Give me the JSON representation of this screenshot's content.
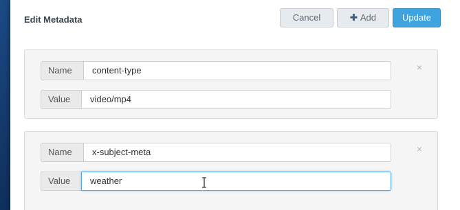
{
  "dialog": {
    "title": "Edit Metadata"
  },
  "toolbar": {
    "cancel_label": "Cancel",
    "add_icon": "plus-icon",
    "add_label": "Add",
    "update_label": "Update"
  },
  "entries": [
    {
      "name_label": "Name",
      "name_value": "content-type",
      "value_label": "Value",
      "value_value": "video/mp4",
      "remove_glyph": "×"
    },
    {
      "name_label": "Name",
      "name_value": "x-subject-meta",
      "value_label": "Value",
      "value_value": "weather",
      "remove_glyph": "×"
    }
  ],
  "colors": {
    "primary": "#3fa3e0",
    "backdrop": "#123a6e"
  }
}
